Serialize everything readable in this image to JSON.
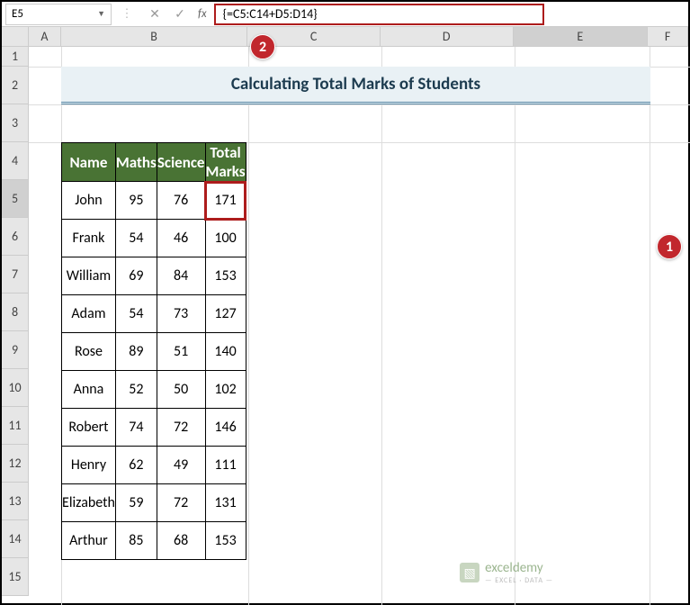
{
  "nameBox": "E5",
  "formula": "{=C5:C14+D5:D14}",
  "colHeaders": [
    "A",
    "B",
    "C",
    "D",
    "E",
    "F"
  ],
  "rowHeaders": [
    "1",
    "2",
    "3",
    "4",
    "5",
    "6",
    "7",
    "8",
    "9",
    "10",
    "11",
    "12",
    "13",
    "14",
    "15"
  ],
  "title": "Calculating Total Marks of Students",
  "headers": {
    "name": "Name",
    "maths": "Maths",
    "science": "Science",
    "total": "Total Marks"
  },
  "rows": [
    {
      "name": "John",
      "maths": "95",
      "science": "76",
      "total": "171"
    },
    {
      "name": "Frank",
      "maths": "54",
      "science": "46",
      "total": "100"
    },
    {
      "name": "William",
      "maths": "69",
      "science": "84",
      "total": "153"
    },
    {
      "name": "Adam",
      "maths": "54",
      "science": "73",
      "total": "127"
    },
    {
      "name": "Rose",
      "maths": "89",
      "science": "51",
      "total": "140"
    },
    {
      "name": "Anna",
      "maths": "52",
      "science": "50",
      "total": "102"
    },
    {
      "name": "Robert",
      "maths": "74",
      "science": "72",
      "total": "146"
    },
    {
      "name": "Henry",
      "maths": "62",
      "science": "49",
      "total": "111"
    },
    {
      "name": "Elizabeth",
      "maths": "59",
      "science": "72",
      "total": "131"
    },
    {
      "name": "Arthur",
      "maths": "85",
      "science": "68",
      "total": "153"
    }
  ],
  "callouts": {
    "c1": "1",
    "c2": "2"
  },
  "watermark": {
    "main": "exceldemy",
    "sub": "— EXCEL · DATA —"
  }
}
